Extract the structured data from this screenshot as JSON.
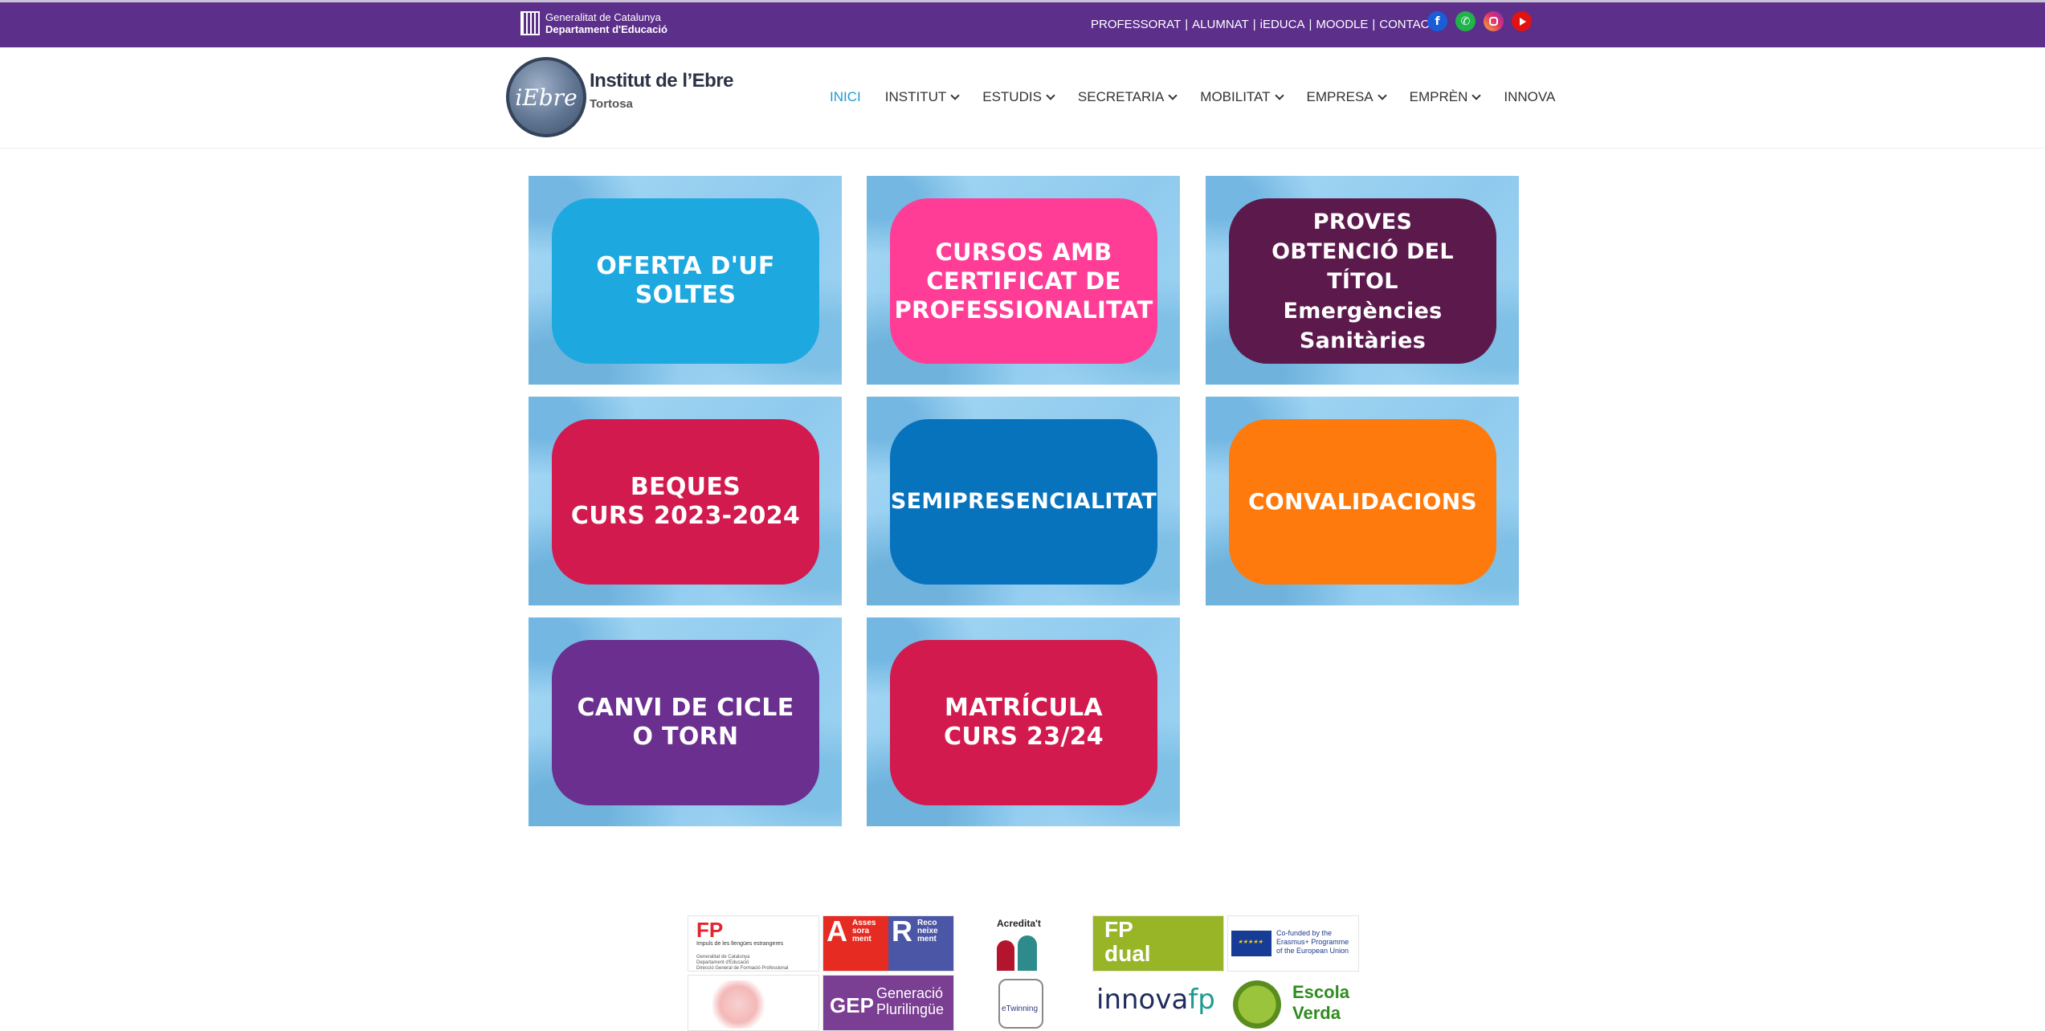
{
  "topbar": {
    "gencat_line1": "Generalitat de Catalunya",
    "gencat_line2": "Departament d'Educació",
    "links": [
      "PROFESSORAT",
      "ALUMNAT",
      "iEDUCA",
      "MOODLE",
      "CONTACTE"
    ],
    "separator": "|",
    "social": [
      "facebook-icon",
      "whatsapp-icon",
      "instagram-icon",
      "youtube-icon"
    ]
  },
  "header": {
    "logo_badge": "iEbre",
    "logo_title": "Institut de l’Ebre",
    "logo_subtitle": "Tortosa",
    "nav": [
      {
        "label": "INICI",
        "dropdown": false,
        "active": true
      },
      {
        "label": "INSTITUT",
        "dropdown": true
      },
      {
        "label": "ESTUDIS",
        "dropdown": true
      },
      {
        "label": "SECRETARIA",
        "dropdown": true
      },
      {
        "label": "MOBILITAT",
        "dropdown": true
      },
      {
        "label": "EMPRESA",
        "dropdown": true
      },
      {
        "label": "EMPRÈN",
        "dropdown": true
      },
      {
        "label": "INNOVA",
        "dropdown": false
      }
    ]
  },
  "tiles": [
    {
      "label": "OFERTA D'UF\nSOLTES",
      "color": "#1ea8e0"
    },
    {
      "label": "CURSOS AMB\nCERTIFICAT DE\nPROFESSIONALITAT",
      "color": "#ff3d96"
    },
    {
      "label": "PROVES\nOBTENCIÓ DEL TÍTOL\nEmergències\nSanitàries",
      "color": "#5c1a4c"
    },
    {
      "label": "BEQUES\nCURS 2023-2024",
      "color": "#d21a4e"
    },
    {
      "label": "SEMIPRESENCIALITAT",
      "color": "#0873bd"
    },
    {
      "label": "CONVALIDACIONS",
      "color": "#ff7a0d"
    },
    {
      "label": "CANVI DE CICLE\nO TORN",
      "color": "#6a2f8f"
    },
    {
      "label": "MATRÍCULA\nCURS 23/24",
      "color": "#d21a4e"
    }
  ],
  "footer_logos": {
    "fp": {
      "big": "FP",
      "small": "Impuls de les llengües estrangeres",
      "gen": "Generalitat de Catalunya\nDepartament d'Educació\nDirecció General de Formació Professional"
    },
    "ar": {
      "a_letter": "A",
      "a_words": "Asses\nsora\nment",
      "r_letter": "R",
      "r_words": "Reco\nneixe\nment"
    },
    "acreditat": "Acredita't",
    "fpdual": "FP\ndual",
    "eu": "Co-funded by the\nErasmus+ Programme\nof the European Union",
    "gep": {
      "t1": "GEP",
      "t2": "Generació\nPlurilingüe"
    },
    "etwinning": "eTwinning",
    "innova": {
      "a": "innova",
      "b": "fp"
    },
    "escola": "Escola\nVerda"
  }
}
